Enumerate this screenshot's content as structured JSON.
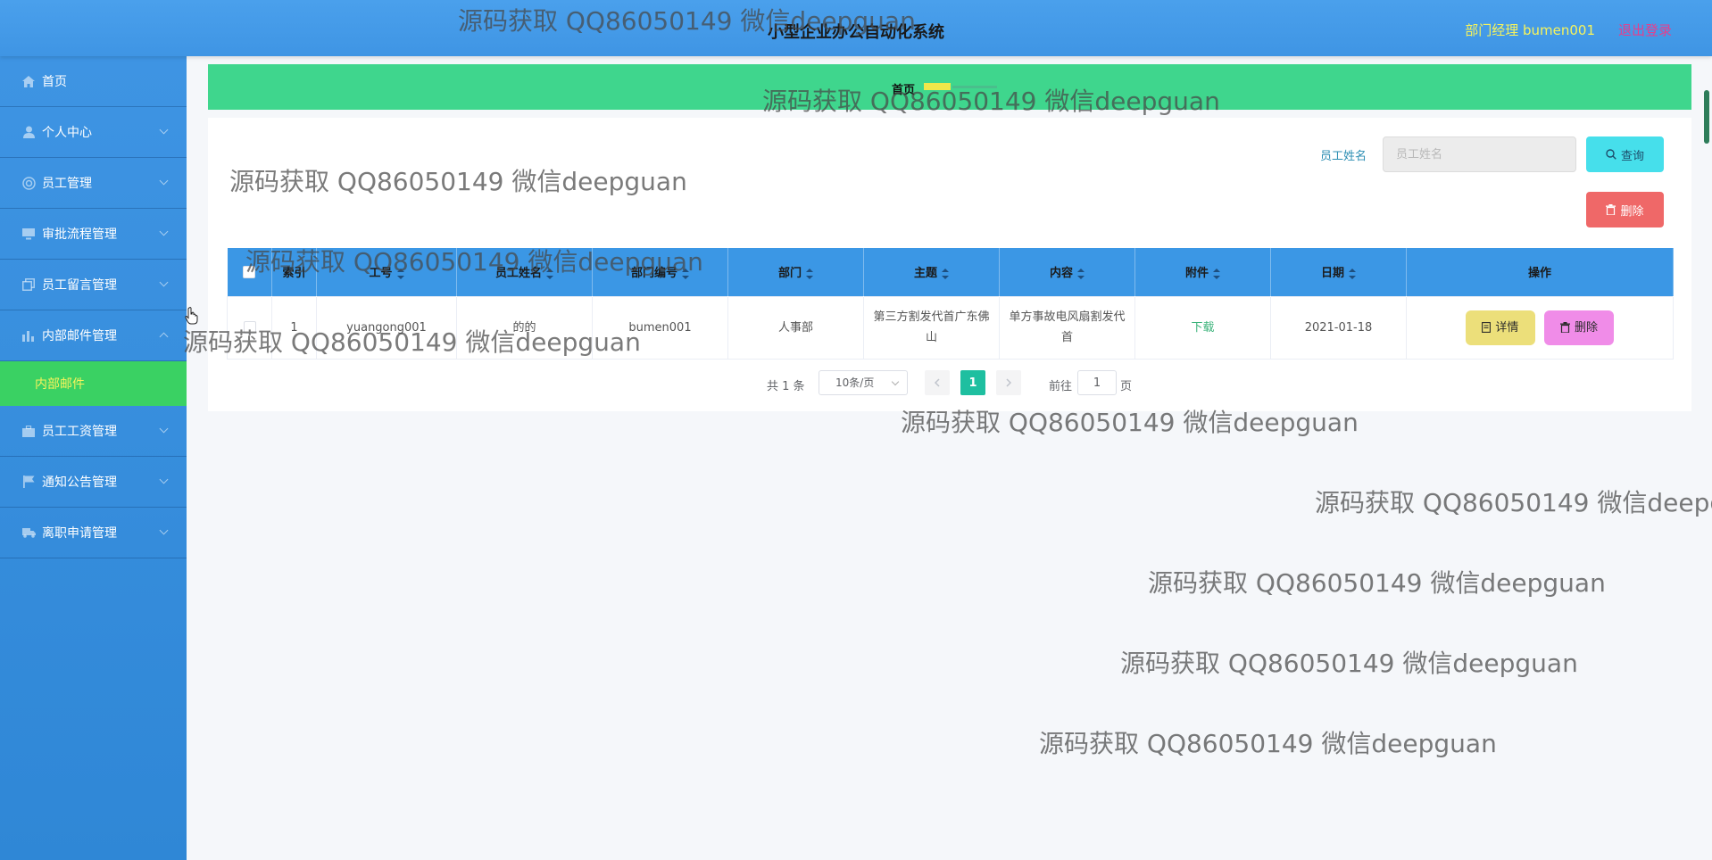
{
  "header": {
    "title": "小型企业办公自动化系统",
    "user": "部门经理 bumen001",
    "logout": "退出登录"
  },
  "sidebar": {
    "items": [
      {
        "label": "首页",
        "icon": "home-icon"
      },
      {
        "label": "个人中心",
        "icon": "user-icon"
      },
      {
        "label": "员工管理",
        "icon": "circle-icon"
      },
      {
        "label": "审批流程管理",
        "icon": "monitor-icon"
      },
      {
        "label": "员工留言管理",
        "icon": "copy-icon"
      },
      {
        "label": "内部邮件管理",
        "icon": "bar-chart-icon"
      },
      {
        "label": "员工工资管理",
        "icon": "briefcase-icon"
      },
      {
        "label": "通知公告管理",
        "icon": "flag-icon"
      },
      {
        "label": "离职申请管理",
        "icon": "truck-icon"
      }
    ],
    "active_sub": "内部邮件"
  },
  "breadcrumb": {
    "home": "首页"
  },
  "search": {
    "label": "员工姓名",
    "placeholder": "员工姓名",
    "query_button": "查询",
    "delete_button": "删除"
  },
  "table": {
    "columns": [
      "索引",
      "工号",
      "员工姓名",
      "部门编号",
      "部门",
      "主题",
      "内容",
      "附件",
      "日期",
      "操作"
    ],
    "rows": [
      {
        "index": "1",
        "job_no": "yuangong001",
        "name": "的的",
        "dept_no": "bumen001",
        "dept": "人事部",
        "subject": "第三方割发代首广东佛山",
        "content": "单方事故电风扇割发代首",
        "attachment": "下载",
        "date": "2021-01-18",
        "detail": "详情",
        "delete": "删除"
      }
    ]
  },
  "pagination": {
    "total": "共 1 条",
    "page_size": "10条/页",
    "current": "1",
    "goto": "前往",
    "goto_value": "1",
    "page_suffix": "页"
  },
  "watermark": "源码获取 QQ86050149 微信deepguan",
  "colors": {
    "header": "#4aa0ec",
    "sidebar": "#3e94e3",
    "active_submenu": "#3ad163",
    "breadcrumb": "#3fd68d",
    "table_header": "#3b97e5",
    "query_button": "#46dfeb",
    "delete_button": "#ef6868"
  }
}
